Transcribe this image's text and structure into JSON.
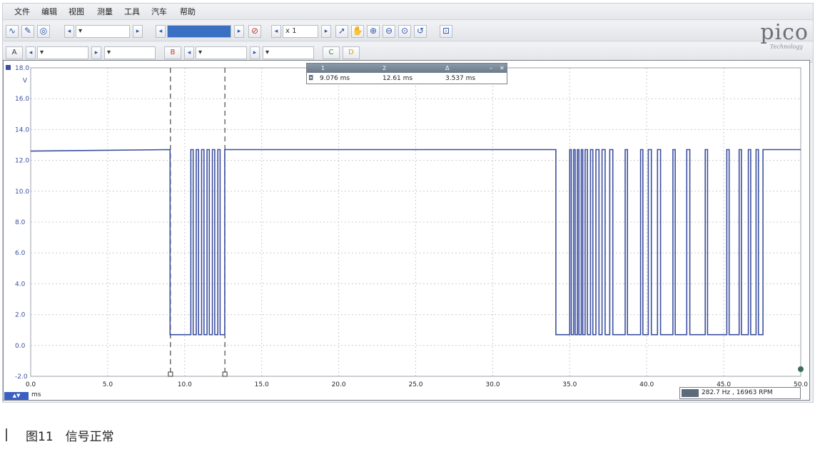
{
  "menu": [
    "文件",
    "编辑",
    "视图",
    "测量",
    "工具",
    "汽车",
    "帮助"
  ],
  "toolbar1": {
    "timebase_value": "",
    "zoom_label": "x 1"
  },
  "toolbar2": {
    "channel_a": "A",
    "channel_b": "B",
    "channel_c": "C",
    "channel_d": "D"
  },
  "logo": {
    "text": "pico",
    "sub": "Technology"
  },
  "measurements": {
    "headers": [
      "1",
      "2",
      "Δ"
    ],
    "values": [
      "9.076 ms",
      "12.61 ms",
      "3.537 ms"
    ]
  },
  "readout": "282.7 Hz , 16963 RPM",
  "x_unit": "ms",
  "y_unit": "V",
  "caption": "图11　信号正常",
  "colors": {
    "trace": "#3b4fa0",
    "grid": "#c8ccd2",
    "cursor": "#222222"
  },
  "chart_data": {
    "type": "line",
    "ylabel": "V",
    "xlabel": "ms",
    "xlim": [
      0,
      50
    ],
    "ylim": [
      -2,
      18
    ],
    "x_ticks": [
      "0.0",
      "5.0",
      "10.0",
      "15.0",
      "20.0",
      "25.0",
      "30.0",
      "35.0",
      "40.0",
      "45.0",
      "50.0"
    ],
    "y_ticks": [
      "18.0",
      "16.0",
      "14.0",
      "12.0",
      "10.0",
      "8.0",
      "6.0",
      "4.0",
      "2.0",
      "0.0",
      "-2.0"
    ],
    "cursors_ms": [
      9.076,
      12.61
    ],
    "series": [
      {
        "high_v": 12.7,
        "low_v": 0.7,
        "points": [
          [
            0,
            12.6
          ],
          [
            9.05,
            12.7
          ],
          [
            9.05,
            0.7
          ],
          [
            10.4,
            0.7
          ],
          [
            10.4,
            12.7
          ],
          [
            10.55,
            12.7
          ],
          [
            10.55,
            0.7
          ],
          [
            10.75,
            0.7
          ],
          [
            10.75,
            12.7
          ],
          [
            10.9,
            12.7
          ],
          [
            10.9,
            0.7
          ],
          [
            11.1,
            0.7
          ],
          [
            11.1,
            12.7
          ],
          [
            11.25,
            12.7
          ],
          [
            11.25,
            0.7
          ],
          [
            11.45,
            0.7
          ],
          [
            11.45,
            12.7
          ],
          [
            11.6,
            12.7
          ],
          [
            11.6,
            0.7
          ],
          [
            11.8,
            0.7
          ],
          [
            11.8,
            12.7
          ],
          [
            11.95,
            12.7
          ],
          [
            11.95,
            0.7
          ],
          [
            12.15,
            0.7
          ],
          [
            12.15,
            12.7
          ],
          [
            12.3,
            12.7
          ],
          [
            12.3,
            0.7
          ],
          [
            12.6,
            0.7
          ],
          [
            12.6,
            12.7
          ],
          [
            34.1,
            12.7
          ],
          [
            34.1,
            0.7
          ],
          [
            35.0,
            0.7
          ],
          [
            35.0,
            12.7
          ],
          [
            35.1,
            12.7
          ],
          [
            35.1,
            0.7
          ],
          [
            35.25,
            0.7
          ],
          [
            35.25,
            12.7
          ],
          [
            35.35,
            12.7
          ],
          [
            35.35,
            0.7
          ],
          [
            35.5,
            0.7
          ],
          [
            35.5,
            12.7
          ],
          [
            35.6,
            12.7
          ],
          [
            35.6,
            0.7
          ],
          [
            35.75,
            0.7
          ],
          [
            35.75,
            12.7
          ],
          [
            35.85,
            12.7
          ],
          [
            35.85,
            0.7
          ],
          [
            36.0,
            0.7
          ],
          [
            36.0,
            12.7
          ],
          [
            36.15,
            12.7
          ],
          [
            36.15,
            0.7
          ],
          [
            36.35,
            0.7
          ],
          [
            36.35,
            12.7
          ],
          [
            36.5,
            12.7
          ],
          [
            36.5,
            0.7
          ],
          [
            36.7,
            0.7
          ],
          [
            36.7,
            12.7
          ],
          [
            36.9,
            12.7
          ],
          [
            36.9,
            0.7
          ],
          [
            37.1,
            0.7
          ],
          [
            37.1,
            12.7
          ],
          [
            37.3,
            12.7
          ],
          [
            37.3,
            0.7
          ],
          [
            37.6,
            0.7
          ],
          [
            37.6,
            12.7
          ],
          [
            37.8,
            12.7
          ],
          [
            37.8,
            0.7
          ],
          [
            38.6,
            0.7
          ],
          [
            38.6,
            12.7
          ],
          [
            38.75,
            12.7
          ],
          [
            38.75,
            0.7
          ],
          [
            39.6,
            0.7
          ],
          [
            39.6,
            12.7
          ],
          [
            39.75,
            12.7
          ],
          [
            39.75,
            0.7
          ],
          [
            40.1,
            0.7
          ],
          [
            40.1,
            12.7
          ],
          [
            40.3,
            12.7
          ],
          [
            40.3,
            0.7
          ],
          [
            40.7,
            0.7
          ],
          [
            40.7,
            12.7
          ],
          [
            40.9,
            12.7
          ],
          [
            40.9,
            0.7
          ],
          [
            41.7,
            0.7
          ],
          [
            41.7,
            12.7
          ],
          [
            41.85,
            12.7
          ],
          [
            41.85,
            0.7
          ],
          [
            42.6,
            0.7
          ],
          [
            42.6,
            12.7
          ],
          [
            42.8,
            12.7
          ],
          [
            42.8,
            0.7
          ],
          [
            43.8,
            0.7
          ],
          [
            43.8,
            12.7
          ],
          [
            43.95,
            12.7
          ],
          [
            43.95,
            0.7
          ],
          [
            45.2,
            0.7
          ],
          [
            45.2,
            12.7
          ],
          [
            45.35,
            12.7
          ],
          [
            45.35,
            0.7
          ],
          [
            46.0,
            0.7
          ],
          [
            46.0,
            12.7
          ],
          [
            46.15,
            12.7
          ],
          [
            46.15,
            0.7
          ],
          [
            46.6,
            0.7
          ],
          [
            46.6,
            12.7
          ],
          [
            46.75,
            12.7
          ],
          [
            46.75,
            0.7
          ],
          [
            47.1,
            0.7
          ],
          [
            47.1,
            12.7
          ],
          [
            47.25,
            12.7
          ],
          [
            47.25,
            0.7
          ],
          [
            47.55,
            0.7
          ],
          [
            47.55,
            12.7
          ],
          [
            50,
            12.7
          ]
        ]
      }
    ]
  }
}
